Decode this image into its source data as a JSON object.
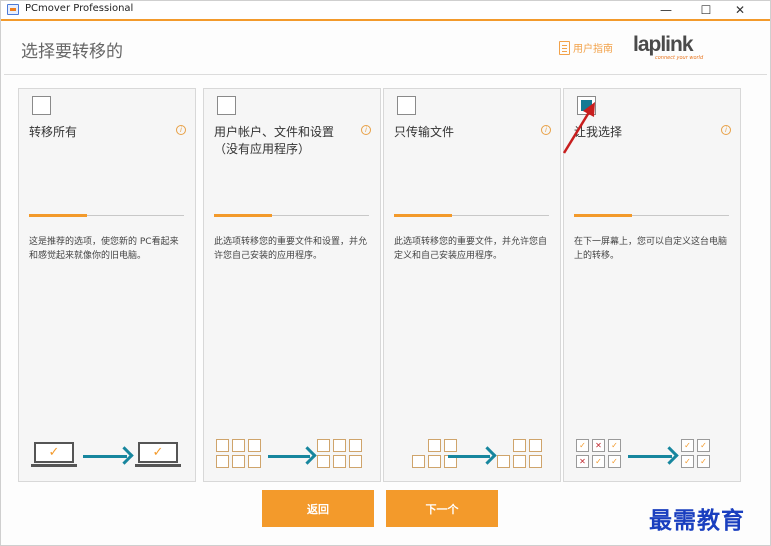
{
  "window": {
    "title": "PCmover Professional",
    "controls": {
      "minimize": "—",
      "maximize": "☐",
      "close": "✕"
    }
  },
  "header": {
    "title": "选择要转移的",
    "guide_label": "用户指南",
    "logo_text": "laplink",
    "logo_tagline": "connect your world"
  },
  "cards": [
    {
      "title": "转移所有",
      "checked": false,
      "description": "这是推荐的选项，使您新的 PC看起来和感觉起来就像你的旧电脑。"
    },
    {
      "title": "用户帐户、文件和设置（没有应用程序）",
      "checked": false,
      "description": "此选项转移您的重要文件和设置，并允许您自己安装的应用程序。"
    },
    {
      "title": "只传输文件",
      "checked": false,
      "description": "此选项转移您的重要文件，并允许您自定义和自己安装应用程序。"
    },
    {
      "title": "让我选择",
      "checked": true,
      "description": "在下一屏幕上，您可以自定义这台电脑上的转移。"
    }
  ],
  "buttons": {
    "back": "返回",
    "next": "下一个"
  },
  "watermark": "最需教育",
  "colors": {
    "accent": "#f39a2b",
    "teal": "#137a93",
    "arrow": "#17869e"
  },
  "icons": {
    "info": "i",
    "check": "✓",
    "cross": "✕"
  }
}
